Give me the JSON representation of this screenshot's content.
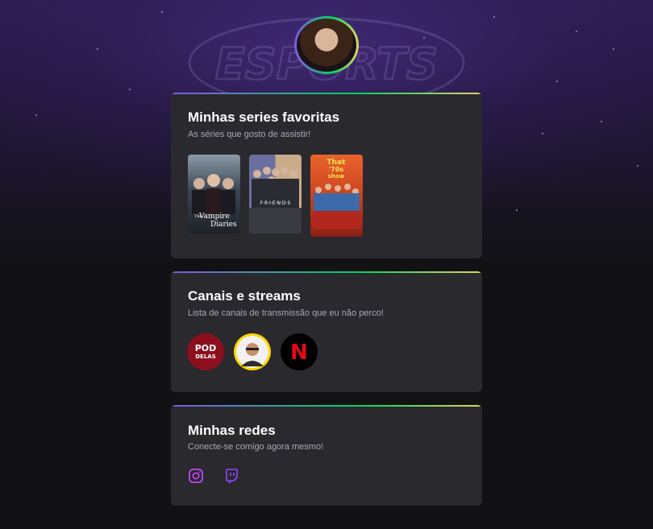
{
  "profile": {
    "avatar_alt": "Foto de perfil",
    "background_logo": "ESPORTS"
  },
  "series": {
    "title": "Minhas series favoritas",
    "subtitle": "As séries que gosto de assistir!",
    "items": [
      {
        "name": "The Vampire Diaries",
        "line1": "The",
        "line2": "Vampire",
        "line3": "Diaries"
      },
      {
        "name": "Friends",
        "logo": "F·R·I·E·N·D·S"
      },
      {
        "name": "That '70s Show",
        "logo1": "That",
        "logo2": "'70s",
        "logo3": "show"
      }
    ]
  },
  "channels": {
    "title": "Canais e streams",
    "subtitle": "Lista de canais de transmissão que eu não perco!",
    "items": [
      {
        "name": "Pod Delas",
        "logo1": "POD",
        "logo2": "DELAS"
      },
      {
        "name": "Streamer"
      },
      {
        "name": "Netflix",
        "logo": "N"
      }
    ]
  },
  "social": {
    "title": "Minhas redes",
    "subtitle": "Conecte-se comigo agora mesmo!",
    "items": [
      {
        "name": "instagram-icon"
      },
      {
        "name": "twitch-icon"
      }
    ]
  },
  "colors": {
    "gradient_start": "#8257e5",
    "gradient_mid": "#04d361",
    "gradient_end": "#e1d55d",
    "card_bg": "#29292e",
    "icon_purple": "#c246f5"
  }
}
